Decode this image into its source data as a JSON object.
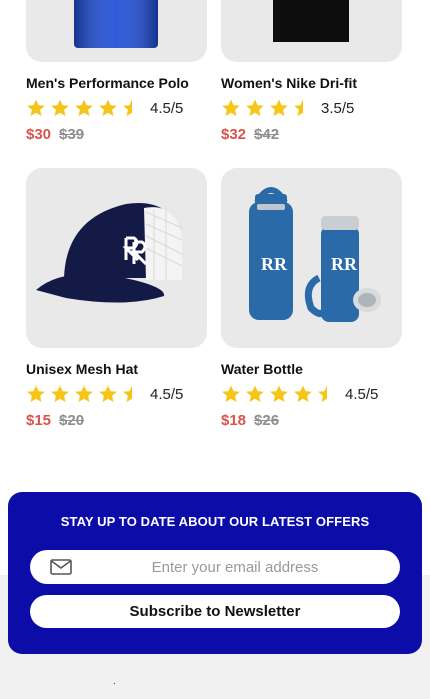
{
  "colors": {
    "accent_blue": "#0c0ca8",
    "star_yellow": "#f5c518",
    "price_red": "#d9534f",
    "price_old_gray": "#8e8e8e"
  },
  "products": [
    {
      "name": "Men's Performance Polo",
      "rating": 4.5,
      "rating_text": "4.5/5",
      "price": "$30",
      "old_price": "$39",
      "image_icon": "blue-polo-shirt"
    },
    {
      "name": "Women's Nike Dri-fit",
      "rating": 3.5,
      "rating_text": "3.5/5",
      "price": "$32",
      "old_price": "$42",
      "image_icon": "black-tank-top"
    },
    {
      "name": "Unisex Mesh Hat",
      "rating": 4.5,
      "rating_text": "4.5/5",
      "price": "$15",
      "old_price": "$20",
      "image_icon": "navy-mesh-cap-rr-logo"
    },
    {
      "name": "Water Bottle",
      "rating": 4.5,
      "rating_text": "4.5/5",
      "price": "$18",
      "old_price": "$26",
      "image_icon": "blue-water-bottles-rr-logo"
    }
  ],
  "newsletter": {
    "title": "STAY UP TO DATE ABOUT OUR LATEST OFFERS",
    "email_placeholder": "Enter your email address",
    "email_value": "",
    "subscribe_label": "Subscribe to Newsletter",
    "email_icon": "envelope-icon"
  },
  "footer": {
    "dot": "."
  }
}
